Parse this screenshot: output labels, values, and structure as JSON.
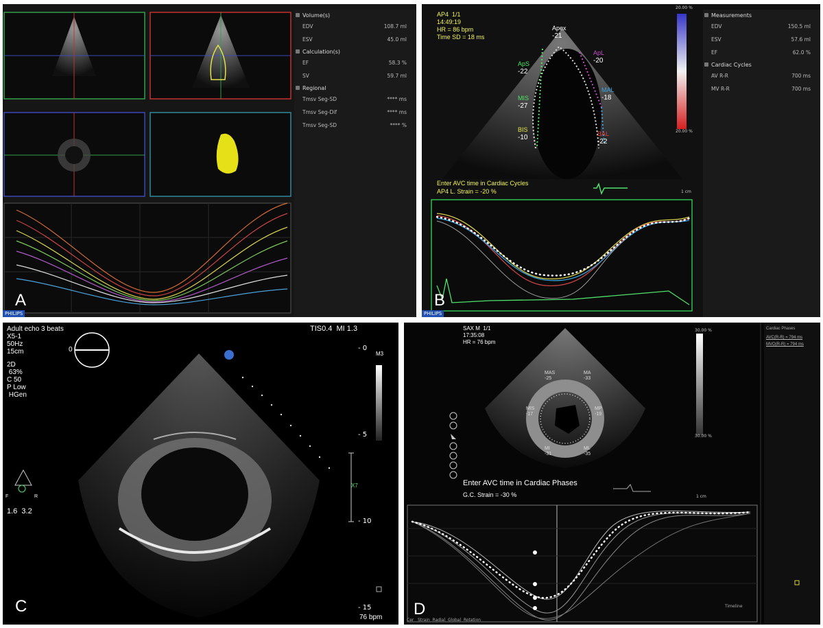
{
  "panels": {
    "a": {
      "label": "A",
      "vendor": "PHILIPS",
      "sections": [
        {
          "header": "Volume(s)",
          "rows": [
            {
              "label": "EDV",
              "value": "108.7 ml"
            },
            {
              "label": "ESV",
              "value": "45.0 ml"
            }
          ]
        },
        {
          "header": "Calculation(s)",
          "rows": [
            {
              "label": "EF",
              "value": "58.3 %"
            },
            {
              "label": "SV",
              "value": "59.7 ml"
            }
          ]
        },
        {
          "header": "Regional",
          "rows": [
            {
              "label": "Tmsv Seg-SD",
              "value": "**** ms"
            },
            {
              "label": "Tmsv Seg-Dif",
              "value": "**** ms"
            },
            {
              "label": "Tmsv Seg-SD",
              "value": "**** %"
            }
          ]
        }
      ]
    },
    "b": {
      "label": "B",
      "vendor": "PHILIPS",
      "header_lines": [
        "AP4  1/1",
        "14:49:19",
        "HR = 86 bpm",
        "Time SD = 18 ms"
      ],
      "segments": [
        {
          "name": "Apex",
          "value": "-21"
        },
        {
          "name": "ApS",
          "value": "-22"
        },
        {
          "name": "MIS",
          "value": "-27"
        },
        {
          "name": "BIS",
          "value": "-10"
        },
        {
          "name": "ApL",
          "value": "-20"
        },
        {
          "name": "MAL",
          "value": "-18"
        },
        {
          "name": "BAL",
          "value": "-22"
        }
      ],
      "scale_top": "20.00 %",
      "scale_bottom": "20.00 %",
      "message": "Enter AVC time in Cardiac Cycles",
      "strain": "AP4 L. Strain = -20 %",
      "scale_unit": "1 cm",
      "sections": [
        {
          "header": "Measurements",
          "rows": [
            {
              "label": "EDV",
              "value": "150.5 ml"
            },
            {
              "label": "ESV",
              "value": "57.6 ml"
            },
            {
              "label": "EF",
              "value": "62.0 %"
            }
          ]
        },
        {
          "header": "Cardiac Cycles",
          "rows": [
            {
              "label": "AV R-R",
              "value": "700 ms"
            },
            {
              "label": "MV R-R",
              "value": "700 ms"
            }
          ]
        }
      ]
    },
    "c": {
      "label": "C",
      "info_lines": [
        "Adult echo 3 beats",
        "X5-1",
        "50Hz",
        "15cm"
      ],
      "mode_lines": [
        "2D",
        " 63%",
        "C 50",
        "P Low",
        " HGen"
      ],
      "probe_angle": "0",
      "tis": "TIS0.4  MI 1.3",
      "m3": "M3",
      "depth_ticks": [
        "0",
        "5",
        "10",
        "15"
      ],
      "focal": "X7",
      "lr_left": "F",
      "lr_right": "R",
      "lr_values": "1.6  3.2",
      "bpm": "76 bpm"
    },
    "d": {
      "label": "D",
      "header_lines": [
        "SAX M  1/1",
        "17:35:08",
        "HR = 76 bpm"
      ],
      "scale_top": "30.00 %",
      "scale_bottom": "30.00 %",
      "seg_labels": [
        "MAS",
        "MA",
        "MIS",
        "MP",
        "MI",
        "ML"
      ],
      "seg_values": [
        "-25",
        "-33",
        "-17",
        "-19",
        "-31",
        "-35"
      ],
      "message": "Enter AVC time in Cardiac Phases",
      "strain": "G.C. Strain = -30 %",
      "scale_unit": "1 cm",
      "side_header": "Cardiac Phases",
      "side_items": [
        "AVC(R-R) = 794 ms",
        "MVO(R-R) = 794 ms"
      ],
      "footer": "Cer   Strain  Radial  Global  Rotation",
      "chart_legend": "Timeline"
    }
  }
}
